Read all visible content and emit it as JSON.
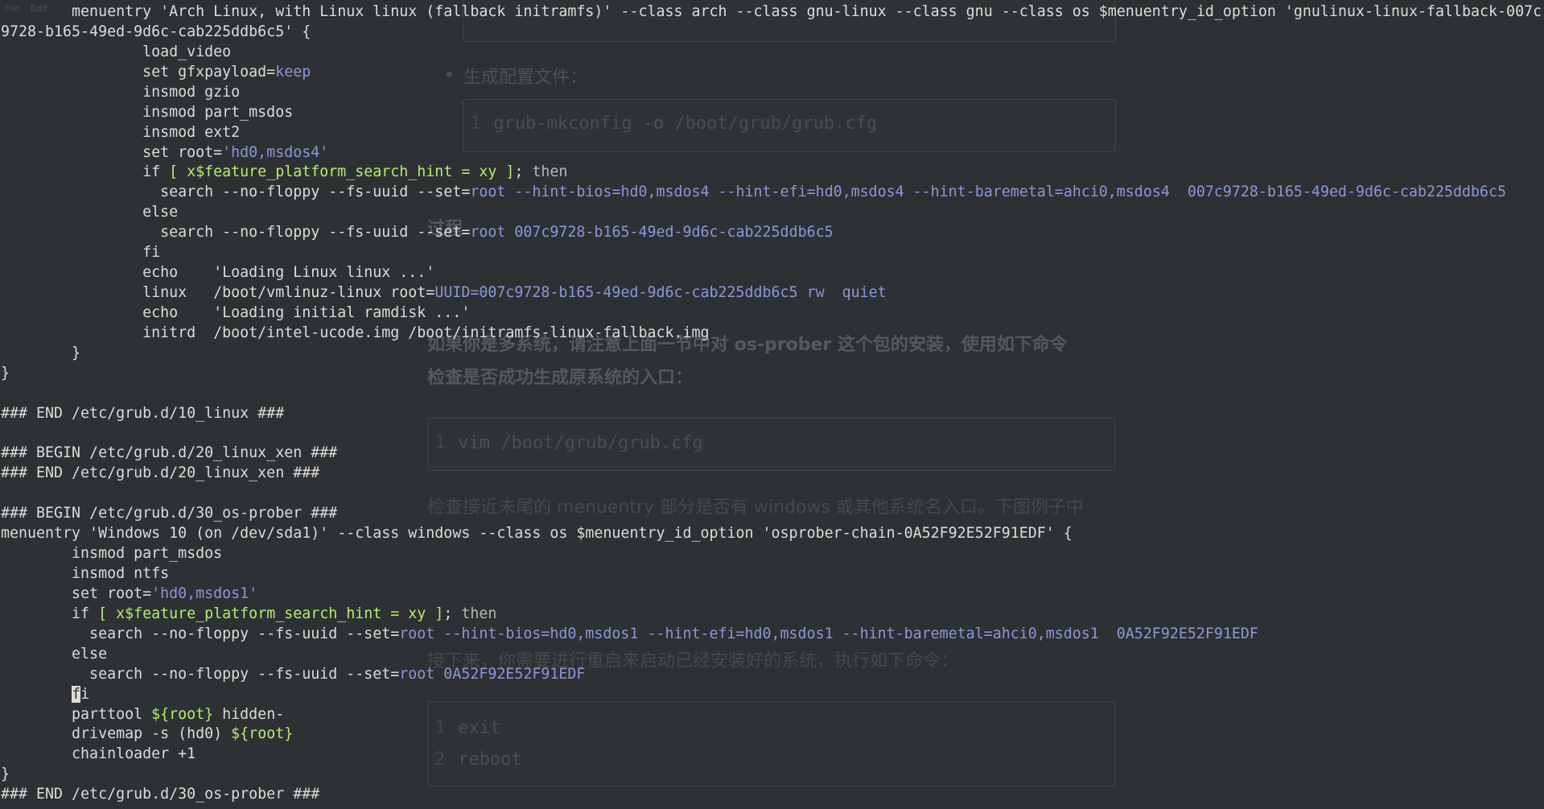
{
  "background_page": {
    "menu": [
      "File",
      "Edit"
    ],
    "bullet_generate_config": "生成配置文件：",
    "code_mkconfig": {
      "line_no": "1",
      "code": "grub-mkconfig",
      "flag": "-o",
      "path": "/boot/grub/grub.cfg"
    },
    "para_fragment": "过程",
    "para_multi_1": "如果你是多系统，请注意上面一节中对 os-prober 这个包的安装，使用如下命令",
    "para_multi_2": "检查是否成功生成原系统的入口：",
    "code_vim": {
      "line_no": "1",
      "code": "vim",
      "path": "/boot/grub/grub.cfg"
    },
    "para_check_1": "检查接近末尾的 menuentry 部分是否有 windows 或其他系统名入口。下图例子中",
    "para_next": "接下来，你需要进行重启来启动已经安装好的系统，执行如下命令：",
    "code_reboot": [
      {
        "line_no": "1",
        "code": "exit"
      },
      {
        "line_no": "2",
        "code": "reboot"
      }
    ]
  },
  "terminal": {
    "colors": {
      "string": "#8b96d9",
      "variable": "#b4ec70",
      "keyword": "#b6b6b0",
      "text": "#dcdcd8",
      "background": "#2e3134"
    },
    "lines": [
      [
        {
          "t": "c",
          "v": "        menuentry 'Arch Linux, with Linux linux (fallback initramfs)' --class arch --class gnu-linux --class gnu --class os $menuentry_id_option 'gnulinux-linux-fallback-007c"
        }
      ],
      [
        {
          "t": "c",
          "v": "9728-b165-49ed-9d6c-cab225ddb6c5' {"
        }
      ],
      [
        {
          "t": "c",
          "v": "                load_video"
        }
      ],
      [
        {
          "t": "c",
          "v": "                set gfxpayload="
        },
        {
          "t": "s",
          "v": "keep"
        }
      ],
      [
        {
          "t": "c",
          "v": "                insmod gzio"
        }
      ],
      [
        {
          "t": "c",
          "v": "                insmod part_msdos"
        }
      ],
      [
        {
          "t": "c",
          "v": "                insmod ext2"
        }
      ],
      [
        {
          "t": "c",
          "v": "                set root="
        },
        {
          "t": "s",
          "v": "'hd0,msdos4'"
        }
      ],
      [
        {
          "t": "c",
          "v": "                if "
        },
        {
          "t": "v",
          "v": "[ x$feature_platform_search_hint = xy ]"
        },
        {
          "t": "c",
          "v": "; "
        },
        {
          "t": "k",
          "v": "then"
        }
      ],
      [
        {
          "t": "c",
          "v": "                  search --no-floppy --fs-uuid --set="
        },
        {
          "t": "s",
          "v": "root --hint-bios=hd0,msdos4 --hint-efi=hd0,msdos4 --hint-baremetal=ahci0,msdos4  007c9728-b165-49ed-9d6c-cab225ddb6c5"
        }
      ],
      [
        {
          "t": "c",
          "v": "                else"
        }
      ],
      [
        {
          "t": "c",
          "v": "                  search --no-floppy --fs-uuid --set="
        },
        {
          "t": "s",
          "v": "root 007c9728-b165-49ed-9d6c-cab225ddb6c5"
        }
      ],
      [
        {
          "t": "c",
          "v": "                fi"
        }
      ],
      [
        {
          "t": "c",
          "v": "                echo    'Loading Linux linux ...'"
        }
      ],
      [
        {
          "t": "c",
          "v": "                linux   /boot/vmlinuz-linux root="
        },
        {
          "t": "s",
          "v": "UUID=007c9728-b165-49ed-9d6c-cab225ddb6c5 rw  quiet"
        }
      ],
      [
        {
          "t": "c",
          "v": "                echo    'Loading initial ramdisk ...'"
        }
      ],
      [
        {
          "t": "c",
          "v": "                initrd  /boot/intel-ucode.img /boot/initramfs-linux-fallback.img"
        }
      ],
      [
        {
          "t": "c",
          "v": "        }"
        }
      ],
      [
        {
          "t": "c",
          "v": "}"
        }
      ],
      [],
      [
        {
          "t": "c",
          "v": "### END /etc/grub.d/10_linux ###"
        }
      ],
      [],
      [
        {
          "t": "c",
          "v": "### BEGIN /etc/grub.d/20_linux_xen ###"
        }
      ],
      [
        {
          "t": "c",
          "v": "### END /etc/grub.d/20_linux_xen ###"
        }
      ],
      [],
      [
        {
          "t": "c",
          "v": "### BEGIN /etc/grub.d/30_os-prober ###"
        }
      ],
      [
        {
          "t": "c",
          "v": "menuentry 'Windows 10 (on /dev/sda1)' --class windows --class os $menuentry_id_option 'osprober-chain-0A52F92E52F91EDF' {"
        }
      ],
      [
        {
          "t": "c",
          "v": "        insmod part_msdos"
        }
      ],
      [
        {
          "t": "c",
          "v": "        insmod ntfs"
        }
      ],
      [
        {
          "t": "c",
          "v": "        set root="
        },
        {
          "t": "s",
          "v": "'hd0,msdos1'"
        }
      ],
      [
        {
          "t": "c",
          "v": "        if "
        },
        {
          "t": "v",
          "v": "[ x$feature_platform_search_hint = xy ]"
        },
        {
          "t": "c",
          "v": "; "
        },
        {
          "t": "k",
          "v": "then"
        }
      ],
      [
        {
          "t": "c",
          "v": "          search --no-floppy --fs-uuid --set="
        },
        {
          "t": "s",
          "v": "root --hint-bios=hd0,msdos1 --hint-efi=hd0,msdos1 --hint-baremetal=ahci0,msdos1  0A52F92E52F91EDF"
        }
      ],
      [
        {
          "t": "c",
          "v": "        else"
        }
      ],
      [
        {
          "t": "c",
          "v": "          search --no-floppy --fs-uuid --set="
        },
        {
          "t": "s",
          "v": "root 0A52F92E52F91EDF"
        }
      ],
      [
        {
          "t": "c",
          "v": "        "
        },
        {
          "t": "cur",
          "v": "f"
        },
        {
          "t": "c",
          "v": "i"
        }
      ],
      [
        {
          "t": "c",
          "v": "        parttool "
        },
        {
          "t": "vb",
          "v": "${root}"
        },
        {
          "t": "c",
          "v": " hidden-"
        }
      ],
      [
        {
          "t": "c",
          "v": "        drivemap -s (hd0) "
        },
        {
          "t": "vb",
          "v": "${root}"
        }
      ],
      [
        {
          "t": "c",
          "v": "        chainloader +1"
        }
      ],
      [
        {
          "t": "c",
          "v": "}"
        }
      ],
      [
        {
          "t": "c",
          "v": "### END /etc/grub.d/30_os-prober ###"
        }
      ]
    ]
  }
}
